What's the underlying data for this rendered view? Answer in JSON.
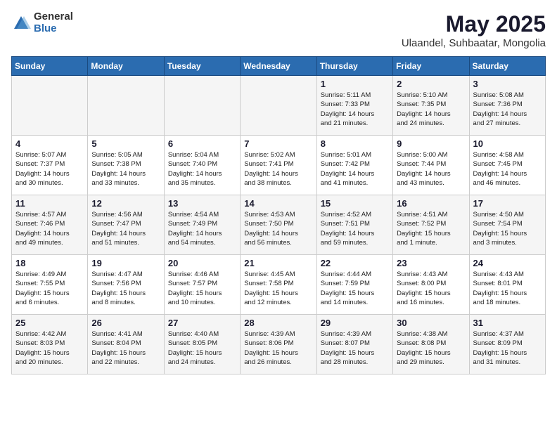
{
  "logo": {
    "general": "General",
    "blue": "Blue"
  },
  "title": "May 2025",
  "subtitle": "Ulaandel, Suhbaatar, Mongolia",
  "days_of_week": [
    "Sunday",
    "Monday",
    "Tuesday",
    "Wednesday",
    "Thursday",
    "Friday",
    "Saturday"
  ],
  "weeks": [
    [
      {
        "num": "",
        "info": ""
      },
      {
        "num": "",
        "info": ""
      },
      {
        "num": "",
        "info": ""
      },
      {
        "num": "",
        "info": ""
      },
      {
        "num": "1",
        "info": "Sunrise: 5:11 AM\nSunset: 7:33 PM\nDaylight: 14 hours\nand 21 minutes."
      },
      {
        "num": "2",
        "info": "Sunrise: 5:10 AM\nSunset: 7:35 PM\nDaylight: 14 hours\nand 24 minutes."
      },
      {
        "num": "3",
        "info": "Sunrise: 5:08 AM\nSunset: 7:36 PM\nDaylight: 14 hours\nand 27 minutes."
      }
    ],
    [
      {
        "num": "4",
        "info": "Sunrise: 5:07 AM\nSunset: 7:37 PM\nDaylight: 14 hours\nand 30 minutes."
      },
      {
        "num": "5",
        "info": "Sunrise: 5:05 AM\nSunset: 7:38 PM\nDaylight: 14 hours\nand 33 minutes."
      },
      {
        "num": "6",
        "info": "Sunrise: 5:04 AM\nSunset: 7:40 PM\nDaylight: 14 hours\nand 35 minutes."
      },
      {
        "num": "7",
        "info": "Sunrise: 5:02 AM\nSunset: 7:41 PM\nDaylight: 14 hours\nand 38 minutes."
      },
      {
        "num": "8",
        "info": "Sunrise: 5:01 AM\nSunset: 7:42 PM\nDaylight: 14 hours\nand 41 minutes."
      },
      {
        "num": "9",
        "info": "Sunrise: 5:00 AM\nSunset: 7:44 PM\nDaylight: 14 hours\nand 43 minutes."
      },
      {
        "num": "10",
        "info": "Sunrise: 4:58 AM\nSunset: 7:45 PM\nDaylight: 14 hours\nand 46 minutes."
      }
    ],
    [
      {
        "num": "11",
        "info": "Sunrise: 4:57 AM\nSunset: 7:46 PM\nDaylight: 14 hours\nand 49 minutes."
      },
      {
        "num": "12",
        "info": "Sunrise: 4:56 AM\nSunset: 7:47 PM\nDaylight: 14 hours\nand 51 minutes."
      },
      {
        "num": "13",
        "info": "Sunrise: 4:54 AM\nSunset: 7:49 PM\nDaylight: 14 hours\nand 54 minutes."
      },
      {
        "num": "14",
        "info": "Sunrise: 4:53 AM\nSunset: 7:50 PM\nDaylight: 14 hours\nand 56 minutes."
      },
      {
        "num": "15",
        "info": "Sunrise: 4:52 AM\nSunset: 7:51 PM\nDaylight: 14 hours\nand 59 minutes."
      },
      {
        "num": "16",
        "info": "Sunrise: 4:51 AM\nSunset: 7:52 PM\nDaylight: 15 hours\nand 1 minute."
      },
      {
        "num": "17",
        "info": "Sunrise: 4:50 AM\nSunset: 7:54 PM\nDaylight: 15 hours\nand 3 minutes."
      }
    ],
    [
      {
        "num": "18",
        "info": "Sunrise: 4:49 AM\nSunset: 7:55 PM\nDaylight: 15 hours\nand 6 minutes."
      },
      {
        "num": "19",
        "info": "Sunrise: 4:47 AM\nSunset: 7:56 PM\nDaylight: 15 hours\nand 8 minutes."
      },
      {
        "num": "20",
        "info": "Sunrise: 4:46 AM\nSunset: 7:57 PM\nDaylight: 15 hours\nand 10 minutes."
      },
      {
        "num": "21",
        "info": "Sunrise: 4:45 AM\nSunset: 7:58 PM\nDaylight: 15 hours\nand 12 minutes."
      },
      {
        "num": "22",
        "info": "Sunrise: 4:44 AM\nSunset: 7:59 PM\nDaylight: 15 hours\nand 14 minutes."
      },
      {
        "num": "23",
        "info": "Sunrise: 4:43 AM\nSunset: 8:00 PM\nDaylight: 15 hours\nand 16 minutes."
      },
      {
        "num": "24",
        "info": "Sunrise: 4:43 AM\nSunset: 8:01 PM\nDaylight: 15 hours\nand 18 minutes."
      }
    ],
    [
      {
        "num": "25",
        "info": "Sunrise: 4:42 AM\nSunset: 8:03 PM\nDaylight: 15 hours\nand 20 minutes."
      },
      {
        "num": "26",
        "info": "Sunrise: 4:41 AM\nSunset: 8:04 PM\nDaylight: 15 hours\nand 22 minutes."
      },
      {
        "num": "27",
        "info": "Sunrise: 4:40 AM\nSunset: 8:05 PM\nDaylight: 15 hours\nand 24 minutes."
      },
      {
        "num": "28",
        "info": "Sunrise: 4:39 AM\nSunset: 8:06 PM\nDaylight: 15 hours\nand 26 minutes."
      },
      {
        "num": "29",
        "info": "Sunrise: 4:39 AM\nSunset: 8:07 PM\nDaylight: 15 hours\nand 28 minutes."
      },
      {
        "num": "30",
        "info": "Sunrise: 4:38 AM\nSunset: 8:08 PM\nDaylight: 15 hours\nand 29 minutes."
      },
      {
        "num": "31",
        "info": "Sunrise: 4:37 AM\nSunset: 8:09 PM\nDaylight: 15 hours\nand 31 minutes."
      }
    ]
  ]
}
